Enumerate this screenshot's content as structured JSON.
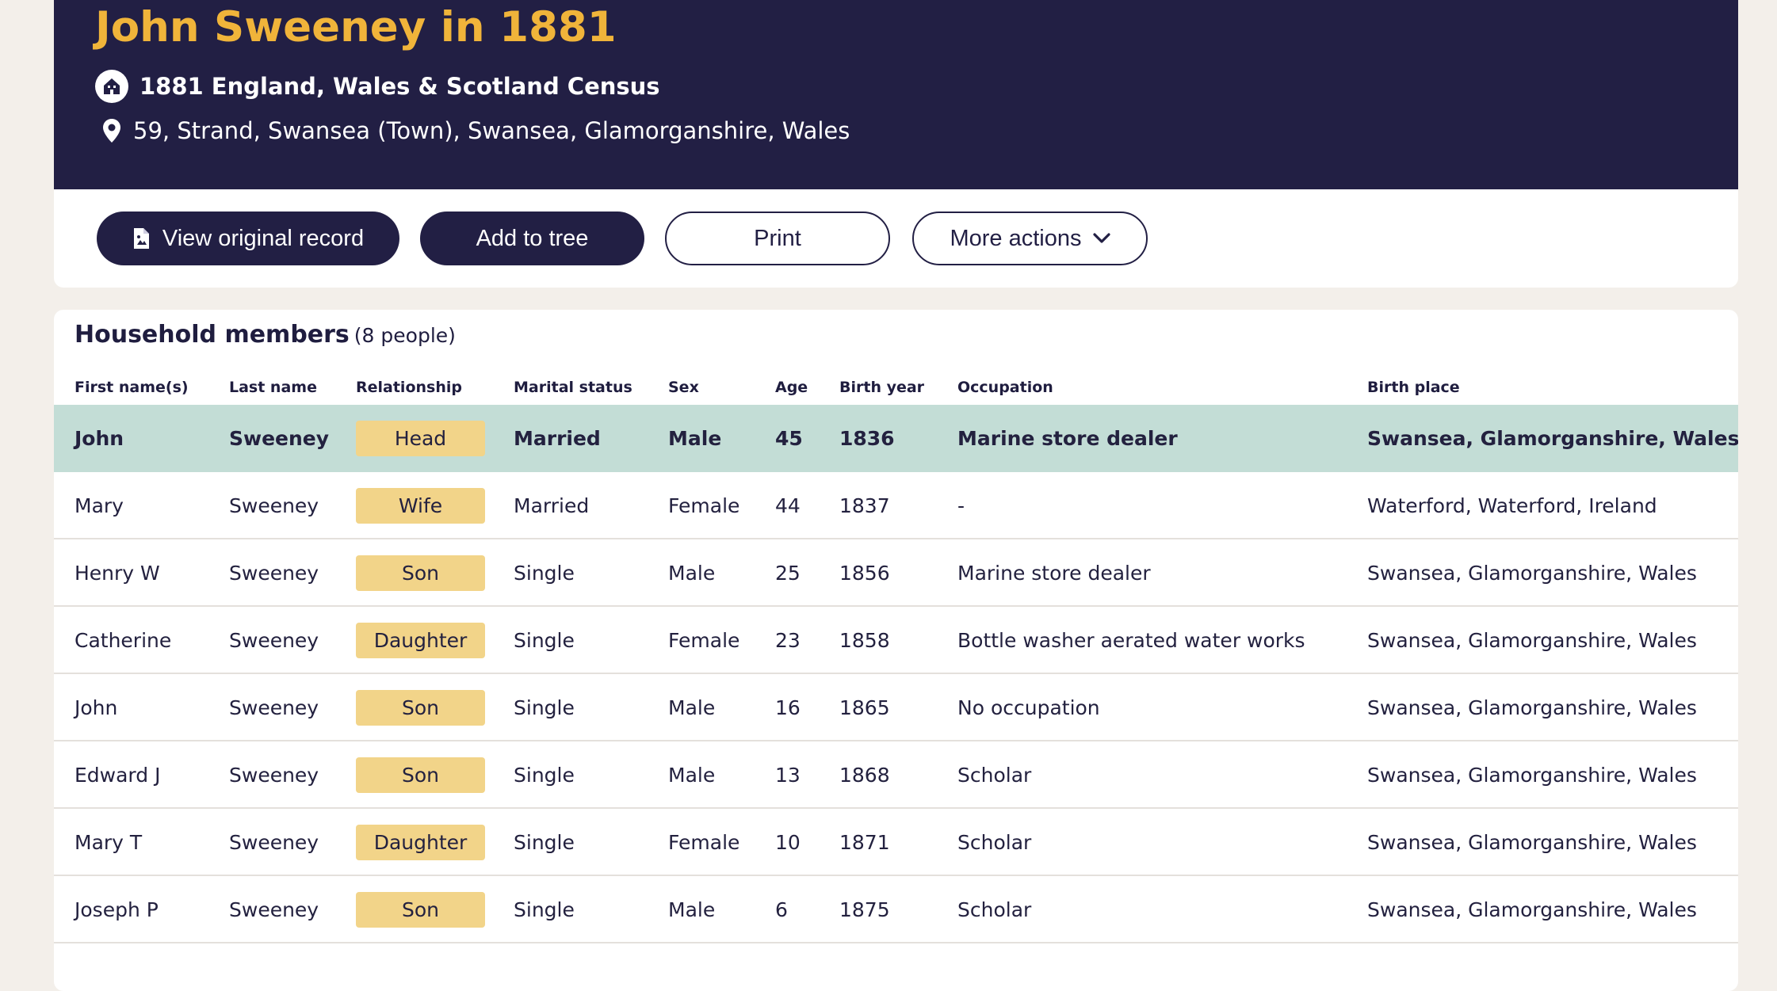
{
  "header": {
    "title": "John Sweeney in 1881",
    "census": "1881 England, Wales & Scotland Census",
    "address": "59, Strand, Swansea (Town), Swansea, Glamorganshire, Wales"
  },
  "actions": {
    "view_original": "View original record",
    "add_to_tree": "Add to tree",
    "print": "Print",
    "more_actions": "More actions"
  },
  "household": {
    "title": "Household members",
    "count": "(8 people)",
    "columns": [
      "First name(s)",
      "Last name",
      "Relationship",
      "Marital status",
      "Sex",
      "Age",
      "Birth year",
      "Occupation",
      "Birth place"
    ],
    "rows": [
      {
        "first": "John",
        "last": "Sweeney",
        "relationship": "Head",
        "marital": "Married",
        "sex": "Male",
        "age": "45",
        "year": "1836",
        "occupation": "Marine store dealer",
        "place": "Swansea, Glamorganshire, Wales"
      },
      {
        "first": "Mary",
        "last": "Sweeney",
        "relationship": "Wife",
        "marital": "Married",
        "sex": "Female",
        "age": "44",
        "year": "1837",
        "occupation": "-",
        "place": "Waterford, Waterford, Ireland"
      },
      {
        "first": "Henry W",
        "last": "Sweeney",
        "relationship": "Son",
        "marital": "Single",
        "sex": "Male",
        "age": "25",
        "year": "1856",
        "occupation": "Marine store dealer",
        "place": "Swansea, Glamorganshire, Wales"
      },
      {
        "first": "Catherine",
        "last": "Sweeney",
        "relationship": "Daughter",
        "marital": "Single",
        "sex": "Female",
        "age": "23",
        "year": "1858",
        "occupation": "Bottle washer aerated water works",
        "place": "Swansea, Glamorganshire, Wales"
      },
      {
        "first": "John",
        "last": "Sweeney",
        "relationship": "Son",
        "marital": "Single",
        "sex": "Male",
        "age": "16",
        "year": "1865",
        "occupation": "No occupation",
        "place": "Swansea, Glamorganshire, Wales"
      },
      {
        "first": "Edward J",
        "last": "Sweeney",
        "relationship": "Son",
        "marital": "Single",
        "sex": "Male",
        "age": "13",
        "year": "1868",
        "occupation": "Scholar",
        "place": "Swansea, Glamorganshire, Wales"
      },
      {
        "first": "Mary T",
        "last": "Sweeney",
        "relationship": "Daughter",
        "marital": "Single",
        "sex": "Female",
        "age": "10",
        "year": "1871",
        "occupation": "Scholar",
        "place": "Swansea, Glamorganshire, Wales"
      },
      {
        "first": "Joseph P",
        "last": "Sweeney",
        "relationship": "Son",
        "marital": "Single",
        "sex": "Male",
        "age": "6",
        "year": "1875",
        "occupation": "Scholar",
        "place": "Swansea, Glamorganshire, Wales"
      }
    ]
  },
  "icons": {
    "census": "census-house-icon",
    "location": "location-pin-icon",
    "document": "document-image-icon",
    "chevron": "chevron-down-icon"
  },
  "colors": {
    "navy": "#221f44",
    "title_gold": "#f0b43a",
    "badge": "#f2d489",
    "highlight_row": "#c3ddd6",
    "background": "#f3efea"
  }
}
